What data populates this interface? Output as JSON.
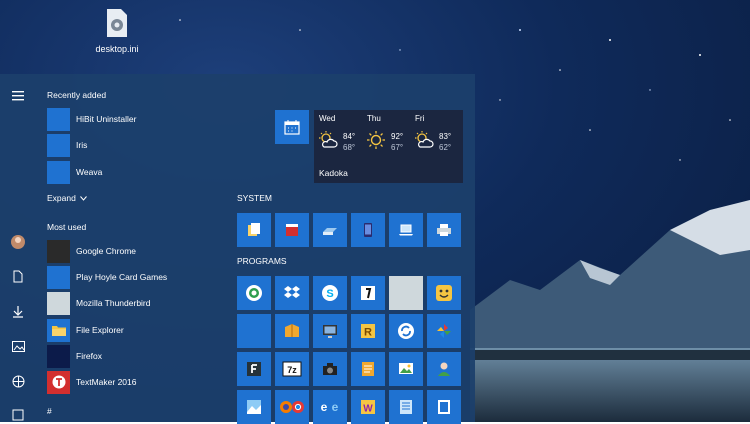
{
  "desktop": {
    "icons": [
      {
        "label": "desktop.ini"
      }
    ]
  },
  "start_menu": {
    "recently_added_heading": "Recently added",
    "recently_added": [
      {
        "label": "HiBit Uninstaller",
        "color": "#1f72d1"
      },
      {
        "label": "Iris",
        "color": "#1f72d1"
      },
      {
        "label": "Weava",
        "color": "#1f72d1"
      }
    ],
    "expand_label": "Expand",
    "most_used_heading": "Most used",
    "most_used": [
      {
        "label": "Google Chrome",
        "color": "#2a2a2a"
      },
      {
        "label": "Play Hoyle Card Games",
        "color": "#1f72d1"
      },
      {
        "label": "Mozilla Thunderbird",
        "color": "#cfd8dc"
      },
      {
        "label": "File Explorer",
        "color": "#1f72d1"
      },
      {
        "label": "Firefox",
        "color": "#0c1b4a"
      },
      {
        "label": "TextMaker 2016",
        "color": "#d32f2f"
      }
    ],
    "hash_heading": "#",
    "rail_icons": [
      "hamburger-icon",
      "user-avatar",
      "document-icon",
      "download-icon",
      "pictures-icon",
      "network-icon",
      "file-icon"
    ]
  },
  "tiles": {
    "weather": {
      "days": [
        {
          "day": "Wed",
          "hi": "84°",
          "lo": "68°",
          "icon": "partly-cloudy"
        },
        {
          "day": "Thu",
          "hi": "92°",
          "lo": "67°",
          "icon": "sunny"
        },
        {
          "day": "Fri",
          "hi": "83°",
          "lo": "62°",
          "icon": "partly-cloudy"
        }
      ],
      "city": "Kadoka"
    },
    "system_heading": "SYSTEM",
    "programs_heading": "PROGRAMS"
  },
  "colors": {
    "accent": "#1f72d1",
    "start_bg": "#1c406c"
  }
}
